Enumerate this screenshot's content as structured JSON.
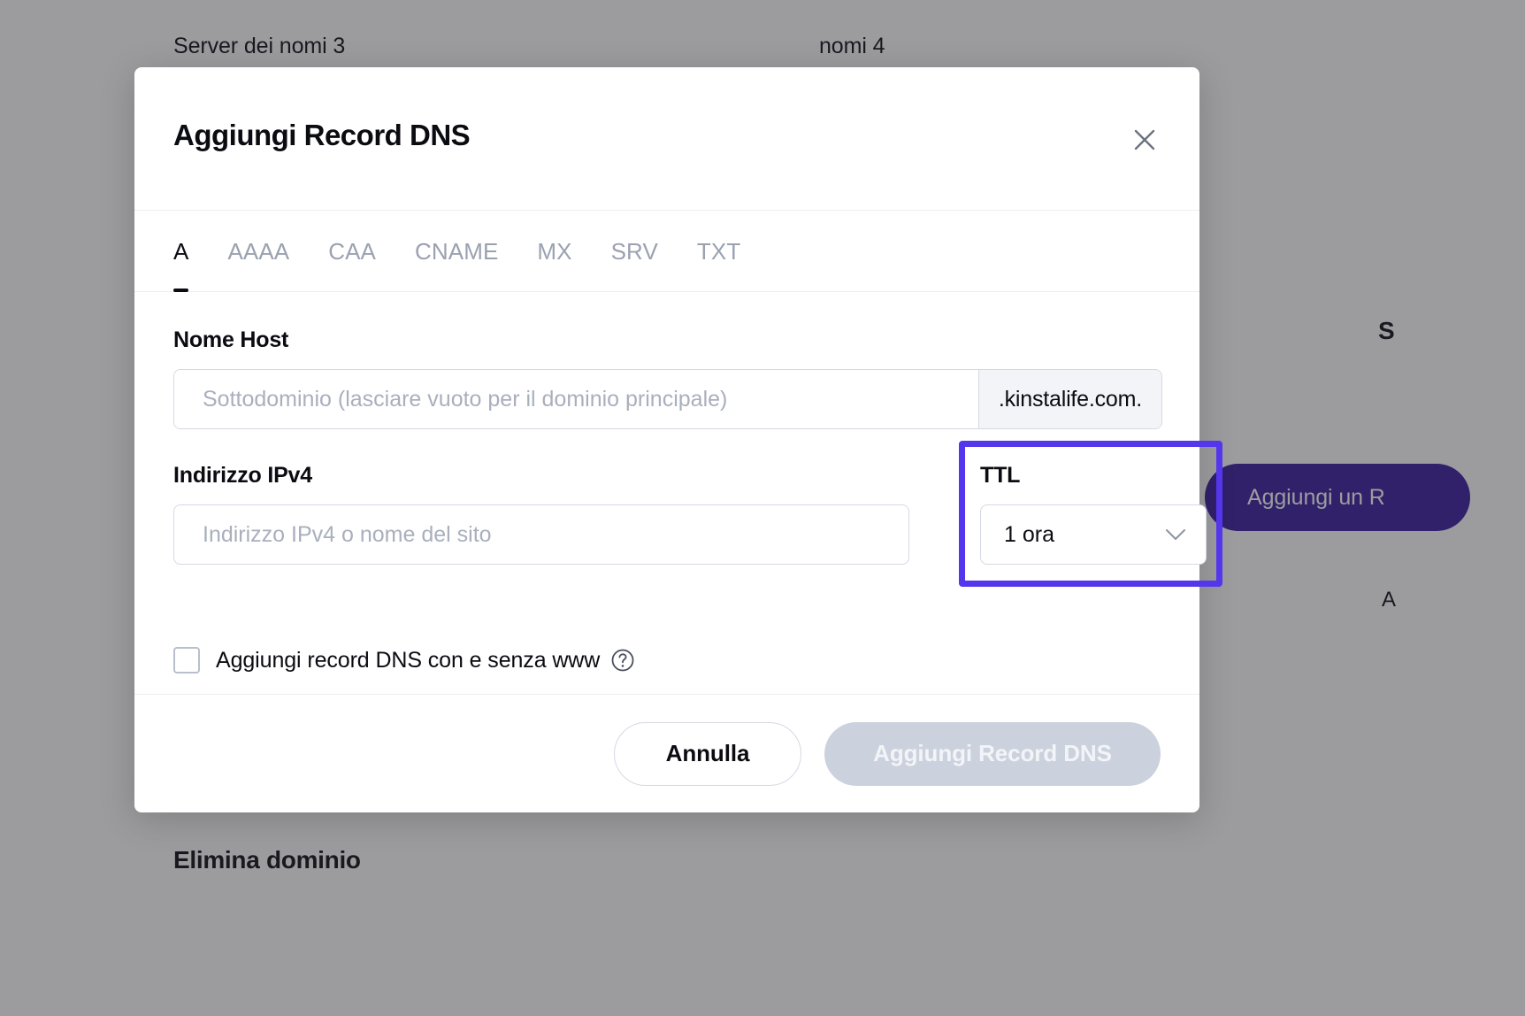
{
  "background": {
    "nameserver_3_label": "Server dei nomi 3",
    "nameserver_4_label": "nomi 4",
    "delete_domain_heading": "Elimina dominio",
    "add_record_button": "Aggiungi un R",
    "partial_s": "S",
    "partial_a": "A",
    "accent_color": "#3a1a9e"
  },
  "modal": {
    "title": "Aggiungi Record DNS",
    "close_icon": "close-icon",
    "tabs": [
      {
        "label": "A",
        "active": true
      },
      {
        "label": "AAAA",
        "active": false
      },
      {
        "label": "CAA",
        "active": false
      },
      {
        "label": "CNAME",
        "active": false
      },
      {
        "label": "MX",
        "active": false
      },
      {
        "label": "SRV",
        "active": false
      },
      {
        "label": "TXT",
        "active": false
      }
    ],
    "host": {
      "label": "Nome Host",
      "placeholder": "Sottodominio (lasciare vuoto per il dominio principale)",
      "value": "",
      "suffix": ".kinstalife.com."
    },
    "ipv4": {
      "label": "Indirizzo IPv4",
      "placeholder": "Indirizzo IPv4 o nome del sito",
      "value": ""
    },
    "ttl": {
      "label": "TTL",
      "selected": "1 ora",
      "caret_icon": "chevron-down-icon",
      "highlight_color": "#5436ec"
    },
    "www_option": {
      "label": "Aggiungi record DNS con e senza www",
      "checked": false,
      "help_icon": "question-circle-icon"
    },
    "footer": {
      "cancel_label": "Annulla",
      "submit_label": "Aggiungi Record DNS",
      "submit_disabled": true
    }
  }
}
